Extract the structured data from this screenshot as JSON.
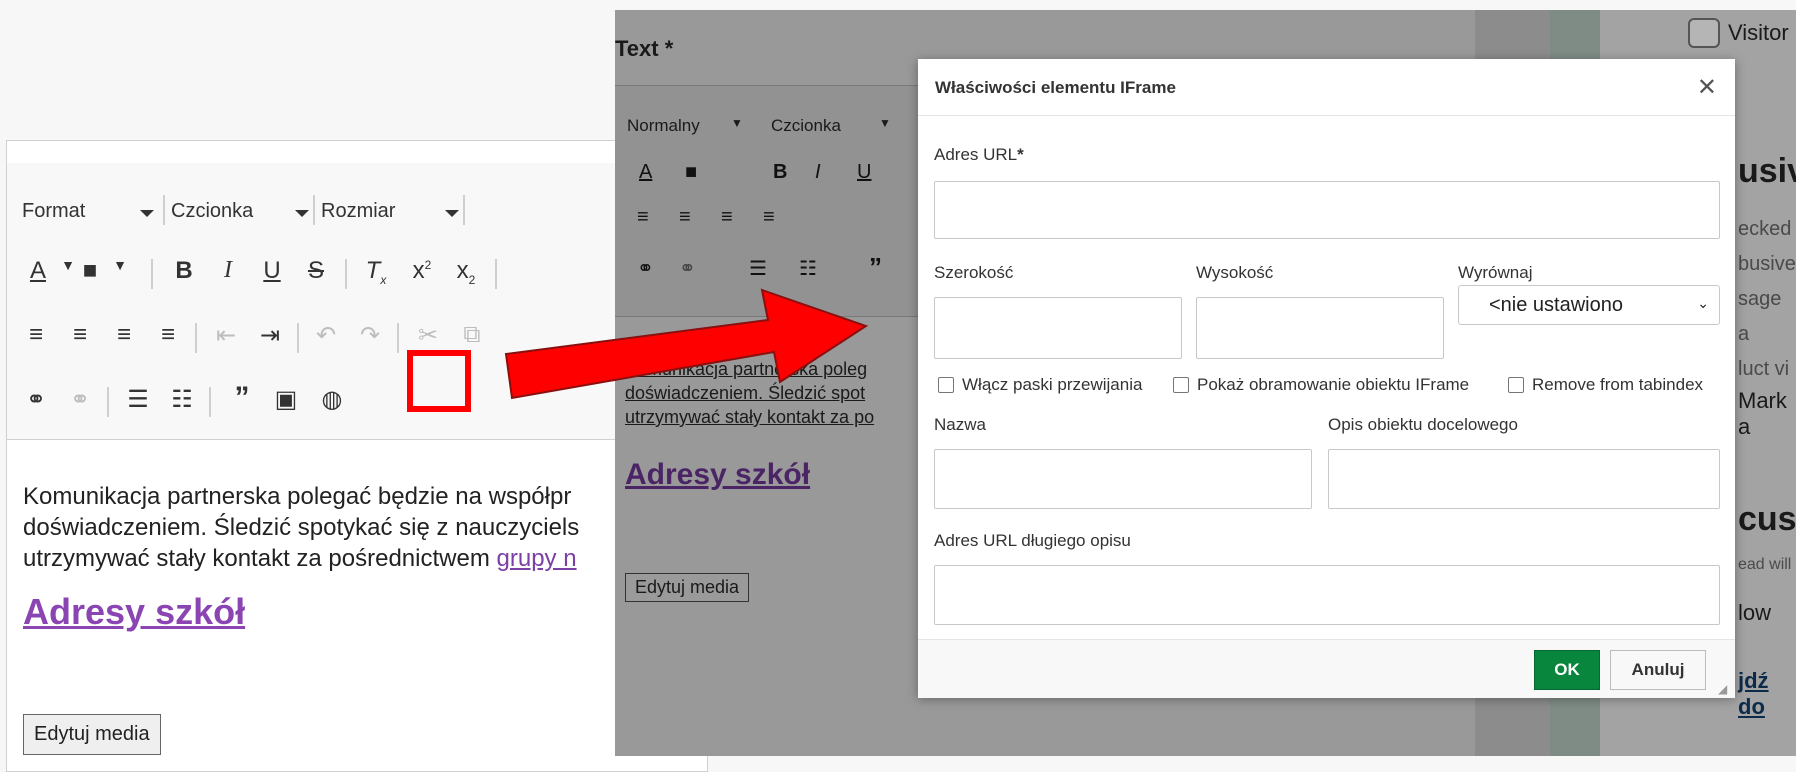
{
  "left_editor": {
    "format_label": "Format",
    "font_label": "Czcionka",
    "size_label": "Rozmiar",
    "paragraph_line1": "Komunikacja partnerska polegać będzie na współpr",
    "paragraph_line2": "doświadczeniem. Śledzić spotykać się z nauczyciels",
    "paragraph_line3_start": "utrzymywać stały kontakt za pośrednictwem ",
    "paragraph_link": "grupy n",
    "heading_link": "Adresy szkół",
    "edit_media_label": "Edytuj media"
  },
  "right_editor": {
    "field_label": "Text *",
    "normal_label": "Normalny",
    "font_label": "Czcionka",
    "paragraph_line1": "Komunikacja partnerska poleg",
    "paragraph_line2": "doświadczeniem. Śledzić spot",
    "paragraph_line3": "utrzymywać stały kontakt za po",
    "heading_link": "Adresy szkół",
    "edit_media_label": "Edytuj media",
    "sidebar_visitor": "Visitor",
    "sidebar_heading1": "usiv",
    "sidebar_line1": "ecked",
    "sidebar_line2": "busive",
    "sidebar_line3": "sage a",
    "sidebar_line4": "luct vi",
    "sidebar_mark": "Mark a",
    "sidebar_heading2": "cus",
    "sidebar_small": "ead will",
    "sidebar_low": "low",
    "sidebar_link": "jdź do"
  },
  "dialog": {
    "title": "Właściwości elementu IFrame",
    "close_glyph": "✕",
    "url_label": "Adres URL",
    "required_marker": "*",
    "width_label": "Szerokość",
    "height_label": "Wysokość",
    "align_label": "Wyrównaj",
    "align_value": "<nie ustawiono",
    "scrollbars_label": "Włącz paski przewijania",
    "border_label": "Pokaż obramowanie obiektu IFrame",
    "tabindex_label": "Remove from tabindex",
    "name_label": "Nazwa",
    "target_desc_label": "Opis obiektu docelowego",
    "long_desc_label": "Adres URL długiego opisu",
    "ok_label": "OK",
    "cancel_label": "Anuluj"
  },
  "colors": {
    "ok_green": "#09863e",
    "annotation_red": "#ff0000",
    "link_purple": "#8a45b3"
  },
  "icons": [
    "text-color-icon",
    "background-color-icon",
    "bold-icon",
    "italic-icon",
    "underline-icon",
    "strikethrough-icon",
    "remove-format-icon",
    "superscript-icon",
    "subscript-icon",
    "align-left-icon",
    "align-center-icon",
    "align-right-icon",
    "justify-icon",
    "outdent-icon",
    "indent-icon",
    "undo-icon",
    "redo-icon",
    "cut-icon",
    "copy-icon",
    "link-icon",
    "unlink-icon",
    "bulleted-list-icon",
    "numbered-list-icon",
    "blockquote-icon",
    "image-icon",
    "iframe-globe-icon",
    "arrow-annotation"
  ]
}
